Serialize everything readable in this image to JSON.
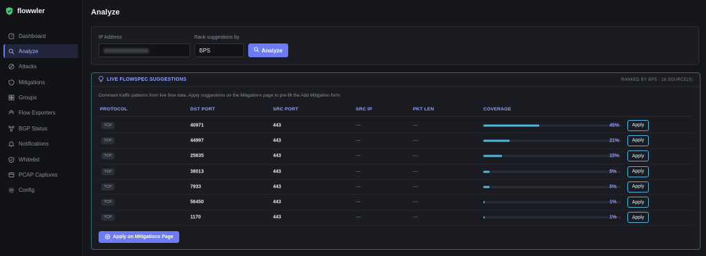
{
  "app": {
    "name": "flowwler"
  },
  "sidebar": {
    "items": [
      {
        "label": "Dashboard",
        "icon": "dashboard-icon",
        "active": false
      },
      {
        "label": "Analyze",
        "icon": "search-icon",
        "active": true
      },
      {
        "label": "Attacks",
        "icon": "attack-icon",
        "active": false
      },
      {
        "label": "Mitigations",
        "icon": "shield-icon",
        "active": false
      },
      {
        "label": "Groups",
        "icon": "groups-icon",
        "active": false
      },
      {
        "label": "Flow Exporters",
        "icon": "exporter-icon",
        "active": false
      },
      {
        "label": "BGP Status",
        "icon": "bgp-icon",
        "active": false
      },
      {
        "label": "Notifications",
        "icon": "bell-icon",
        "active": false
      },
      {
        "label": "Whitelist",
        "icon": "whitelist-icon",
        "active": false
      },
      {
        "label": "PCAP Captures",
        "icon": "capture-icon",
        "active": false
      },
      {
        "label": "Config",
        "icon": "gear-icon",
        "active": false
      }
    ]
  },
  "page": {
    "title": "Analyze"
  },
  "form": {
    "ip_label": "IP Address",
    "rank_label": "Rank suggestions by",
    "rank_value": "BPS",
    "analyze_label": "Analyze"
  },
  "suggestions": {
    "title": "LIVE FLOWSPEC SUGGESTIONS",
    "meta": "RANKED BY BPS · 16 SOURCE(S)",
    "description": "Dominant traffic patterns from live flow data. Apply suggestions on the Mitigations page to pre-fill the Add Mitigation form.",
    "columns": [
      "PROTOCOL",
      "DST PORT",
      "SRC PORT",
      "SRC IP",
      "PKT LEN",
      "COVERAGE"
    ],
    "rows": [
      {
        "protocol": "TCP",
        "dst_port": "40971",
        "src_port": "443",
        "src_ip": "—",
        "pkt_len": "—",
        "coverage": 0.45,
        "coverage_label": "45%",
        "apply": "Apply"
      },
      {
        "protocol": "TCP",
        "dst_port": "44997",
        "src_port": "443",
        "src_ip": "—",
        "pkt_len": "—",
        "coverage": 0.21,
        "coverage_label": "21%",
        "apply": "Apply"
      },
      {
        "protocol": "TCP",
        "dst_port": "25635",
        "src_port": "443",
        "src_ip": "—",
        "pkt_len": "—",
        "coverage": 0.15,
        "coverage_label": "15%",
        "apply": "Apply"
      },
      {
        "protocol": "TCP",
        "dst_port": "38013",
        "src_port": "443",
        "src_ip": "—",
        "pkt_len": "—",
        "coverage": 0.05,
        "coverage_label": "5%",
        "apply": "Apply"
      },
      {
        "protocol": "TCP",
        "dst_port": "7933",
        "src_port": "443",
        "src_ip": "—",
        "pkt_len": "—",
        "coverage": 0.05,
        "coverage_label": "5%",
        "apply": "Apply"
      },
      {
        "protocol": "TCP",
        "dst_port": "56450",
        "src_port": "443",
        "src_ip": "—",
        "pkt_len": "—",
        "coverage": 0.01,
        "coverage_label": "1%",
        "apply": "Apply"
      },
      {
        "protocol": "TCP",
        "dst_port": "1170",
        "src_port": "443",
        "src_ip": "—",
        "pkt_len": "—",
        "coverage": 0.01,
        "coverage_label": "1%",
        "apply": "Apply"
      }
    ],
    "apply_all_label": "Apply on Mitigations Page"
  },
  "colors": {
    "accent": "#6d7cf6",
    "coverage": "#4fb6e3",
    "card_border": "#2f6f6f",
    "brand": "#3ecf6e"
  }
}
